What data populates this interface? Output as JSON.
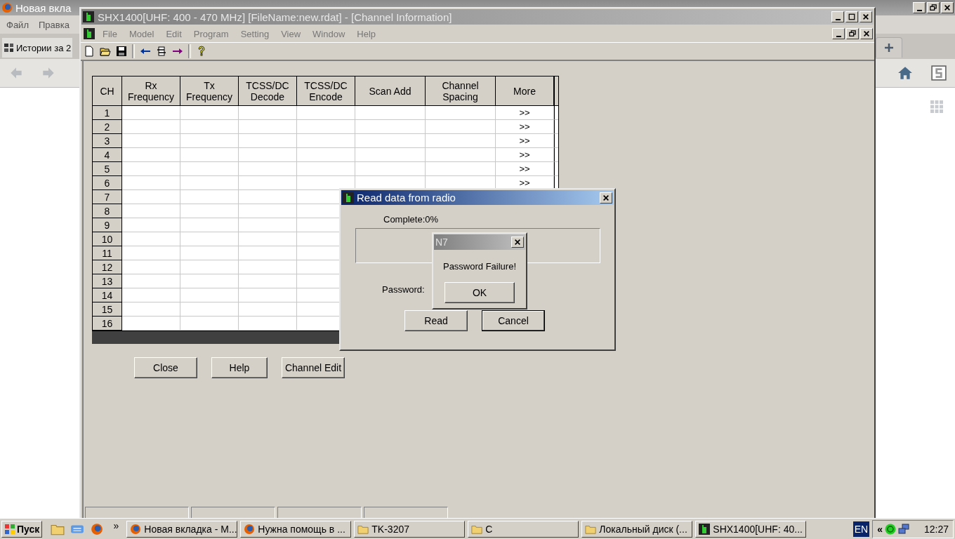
{
  "browser": {
    "title": "Новая вкла",
    "menu": [
      "Файл",
      "Правка"
    ],
    "tab": "Истории за 2"
  },
  "app": {
    "title": "SHX1400[UHF: 400 - 470 MHz] [FileName:new.rdat] - [Channel Information]",
    "menu": [
      "File",
      "Model",
      "Edit",
      "Program",
      "Setting",
      "View",
      "Window",
      "Help"
    ],
    "table": {
      "columns": [
        {
          "lines": [
            "CH"
          ]
        },
        {
          "lines": [
            "Rx",
            "Frequency"
          ]
        },
        {
          "lines": [
            "Tx",
            "Frequency"
          ]
        },
        {
          "lines": [
            "TCSS/DC",
            "Decode"
          ]
        },
        {
          "lines": [
            "TCSS/DC",
            "Encode"
          ]
        },
        {
          "lines": [
            "Scan Add"
          ]
        },
        {
          "lines": [
            "Channel",
            "Spacing"
          ]
        },
        {
          "lines": [
            "More"
          ]
        }
      ],
      "rows": [
        {
          "ch": "1",
          "more": ">>"
        },
        {
          "ch": "2",
          "more": ">>"
        },
        {
          "ch": "3",
          "more": ">>"
        },
        {
          "ch": "4",
          "more": ">>"
        },
        {
          "ch": "5",
          "more": ">>"
        },
        {
          "ch": "6",
          "more": ">>"
        },
        {
          "ch": "7"
        },
        {
          "ch": "8"
        },
        {
          "ch": "9"
        },
        {
          "ch": "10"
        },
        {
          "ch": "11"
        },
        {
          "ch": "12"
        },
        {
          "ch": "13"
        },
        {
          "ch": "14"
        },
        {
          "ch": "15"
        },
        {
          "ch": "16"
        }
      ]
    },
    "buttons": [
      "Close",
      "Help",
      "Channel Edit"
    ]
  },
  "dialog": {
    "title": "Read data from radio",
    "progress_label": "Complete:0%",
    "progress": {
      "level": 0
    },
    "password_label": "Password:",
    "buttons": [
      {
        "label": "Read",
        "default": false
      },
      {
        "label": "Cancel",
        "default": true
      }
    ]
  },
  "message": {
    "title": "N7",
    "text": "Password Failure!",
    "button": "OK"
  },
  "taskbar": {
    "start": "Пуск",
    "more": "»",
    "buttons": [
      {
        "label": "Новая вкладка - М...",
        "kind": "browser"
      },
      {
        "label": "Нужна помощь в ...",
        "kind": "browser"
      },
      {
        "label": "TK-3207",
        "kind": "folder"
      },
      {
        "label": "С",
        "kind": "folder"
      },
      {
        "label": "Локальный диск (...",
        "kind": "folder"
      },
      {
        "label": "SHX1400[UHF: 40...",
        "kind": "app"
      }
    ],
    "language": "EN",
    "tray_toggle": "«",
    "clock": "12:27"
  }
}
